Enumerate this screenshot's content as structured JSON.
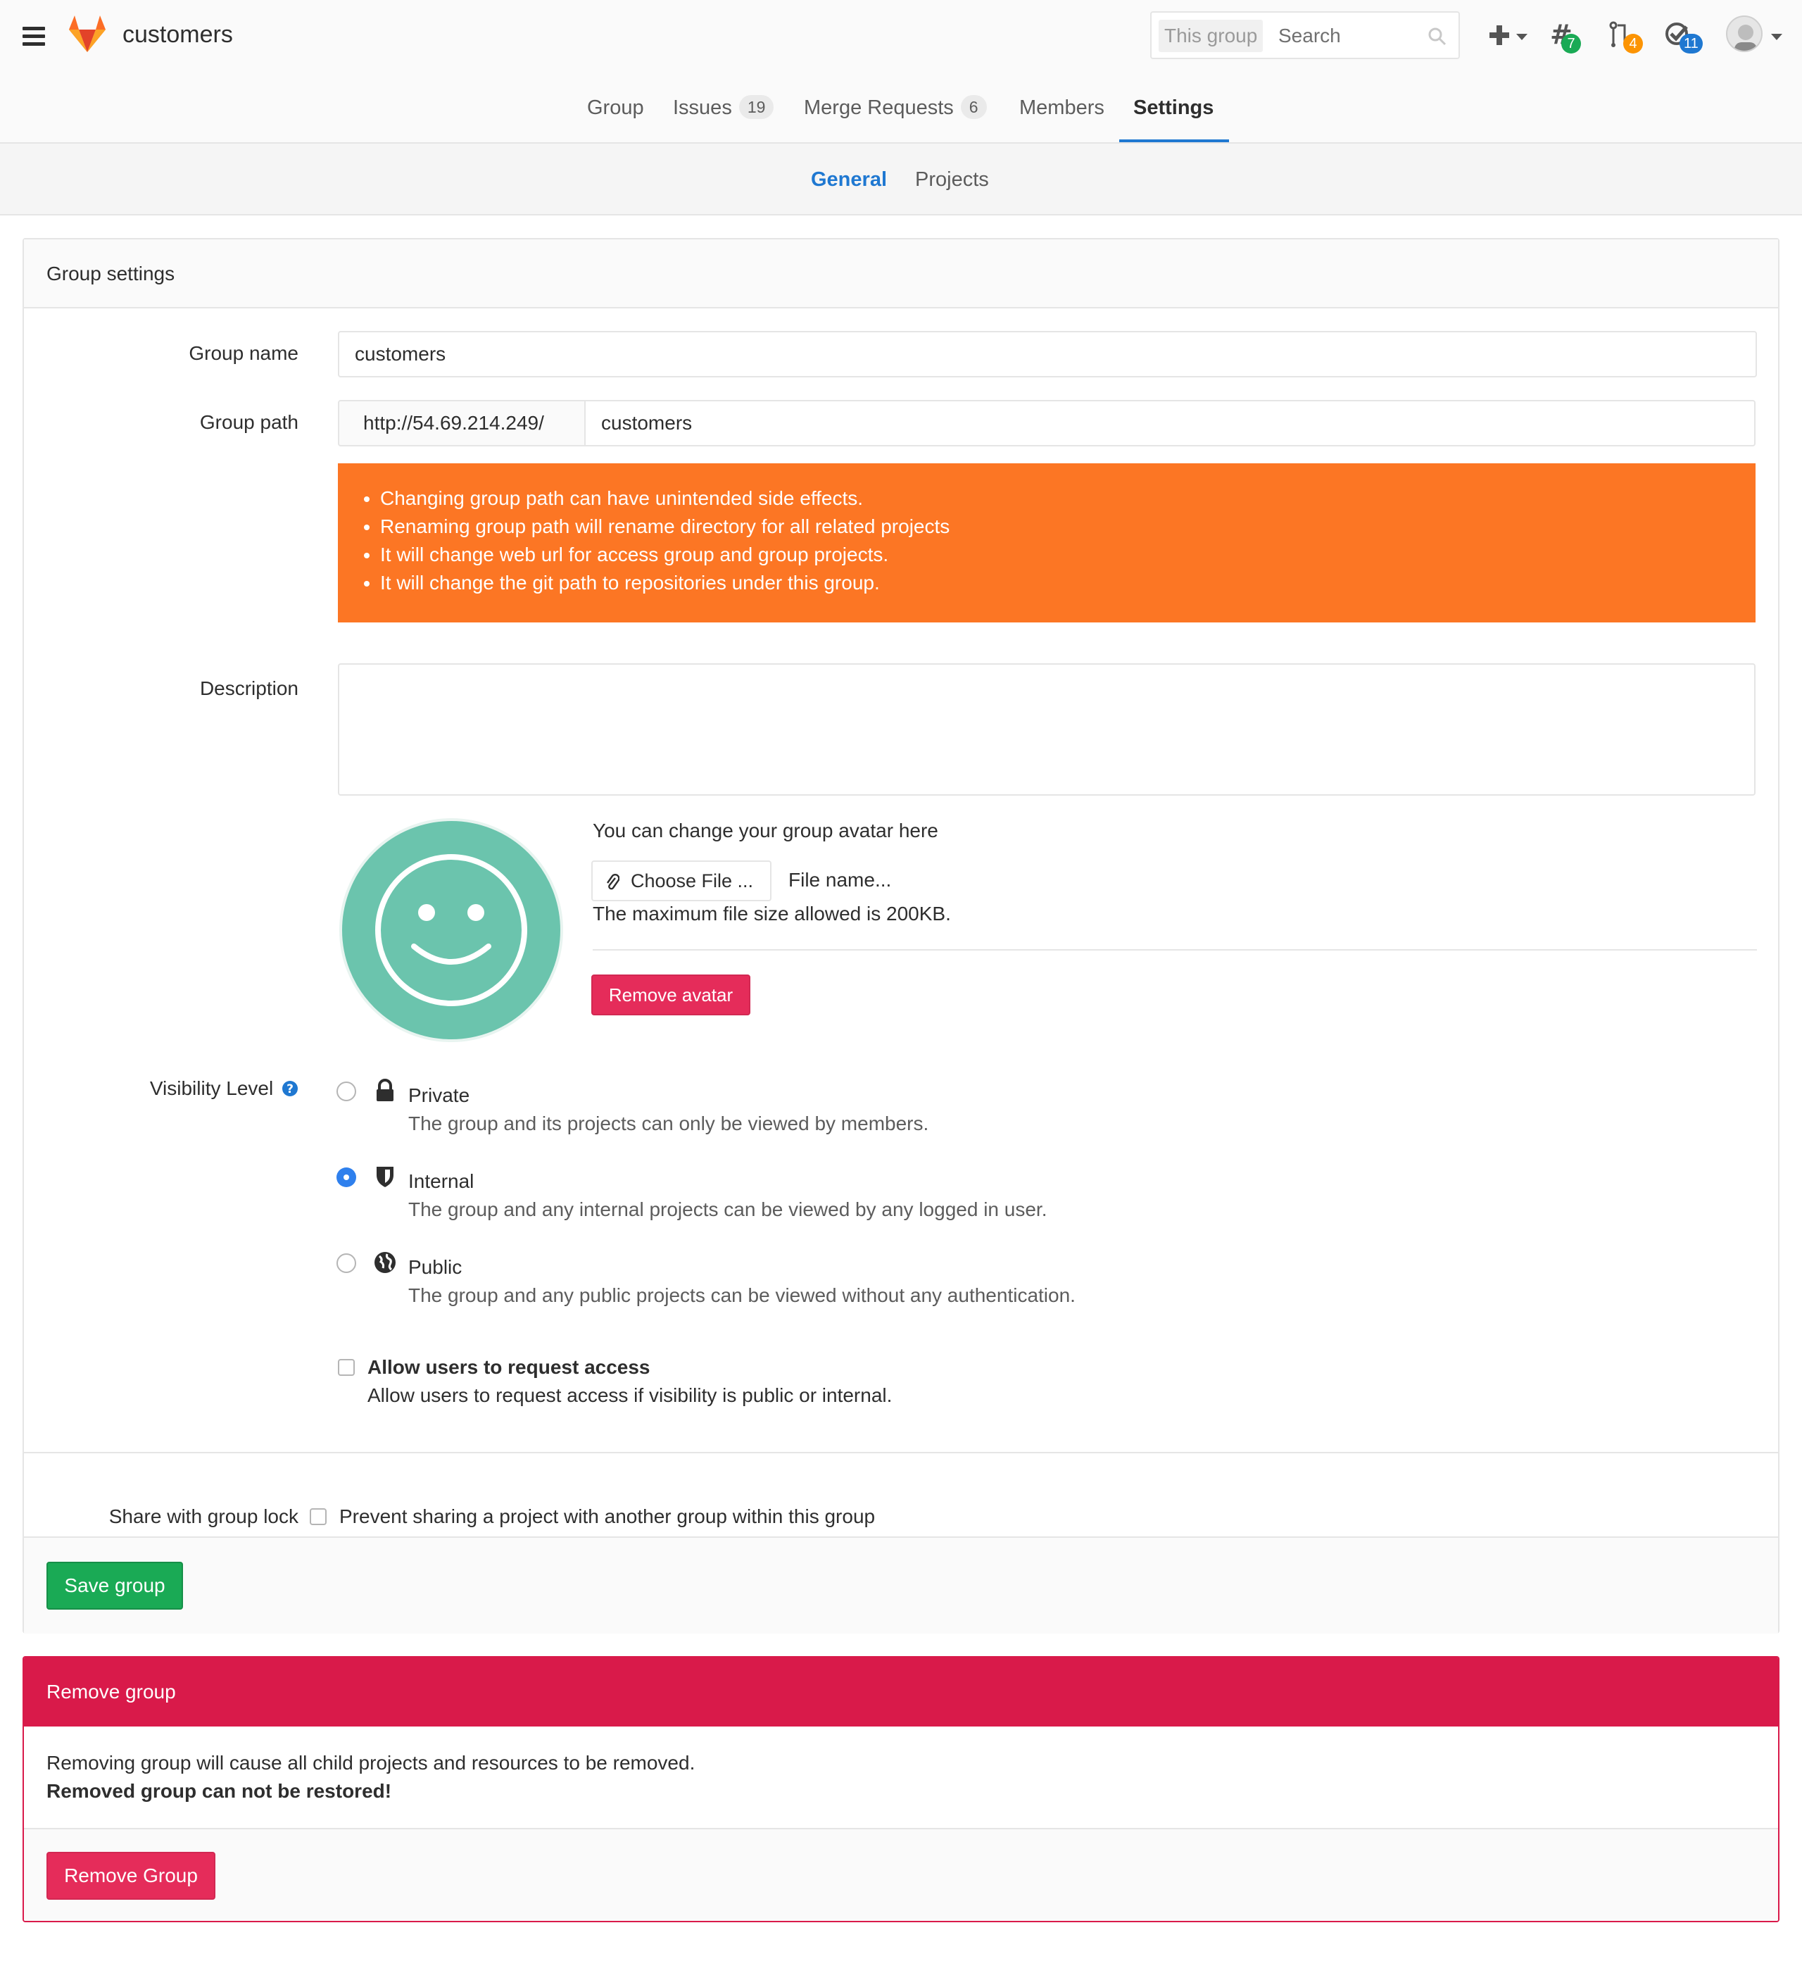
{
  "header": {
    "brand": "customers",
    "search_scope": "This group",
    "search_placeholder": "Search",
    "issues_badge": "7",
    "merge_requests_badge": "4",
    "todos_badge": "11"
  },
  "nav": {
    "group": "Group",
    "issues": "Issues",
    "issues_count": "19",
    "merge_requests": "Merge Requests",
    "merge_requests_count": "6",
    "members": "Members",
    "settings": "Settings"
  },
  "subnav": {
    "general": "General",
    "projects": "Projects"
  },
  "settings": {
    "panel_title": "Group settings",
    "group_name_label": "Group name",
    "group_name_value": "customers",
    "group_path_label": "Group path",
    "group_path_prefix": "http://54.69.214.249/",
    "group_path_value": "customers",
    "warnings": [
      "Changing group path can have unintended side effects.",
      "Renaming group path will rename directory for all related projects",
      "It will change web url for access group and group projects.",
      "It will change the git path to repositories under this group."
    ],
    "description_label": "Description",
    "description_value": "",
    "avatar": {
      "help": "You can change your group avatar here",
      "choose_file": "Choose File ...",
      "file_name": "File name...",
      "max_size": "The maximum file size allowed is 200KB.",
      "remove_avatar": "Remove avatar"
    },
    "visibility_label": "Visibility Level",
    "visibility": {
      "selected": "Internal",
      "options": [
        {
          "title": "Private",
          "desc": "The group and its projects can only be viewed by members."
        },
        {
          "title": "Internal",
          "desc": "The group and any internal projects can be viewed by any logged in user."
        },
        {
          "title": "Public",
          "desc": "The group and any public projects can be viewed without any authentication."
        }
      ]
    },
    "request_access_title": "Allow users to request access",
    "request_access_desc": "Allow users to request access if visibility is public or internal.",
    "share_lock_label": "Share with group lock",
    "share_lock_desc": "Prevent sharing a project with another group within this group",
    "save_button": "Save group"
  },
  "remove": {
    "title": "Remove group",
    "line1": "Removing group will cause all child projects and resources to be removed.",
    "line2": "Removed group can not be restored!",
    "button": "Remove Group"
  },
  "colors": {
    "accent": "#1f78d1",
    "warning": "#fc7624",
    "danger": "#d91a4a",
    "success": "#1aaa55",
    "avatar": "#6bc4ad"
  }
}
